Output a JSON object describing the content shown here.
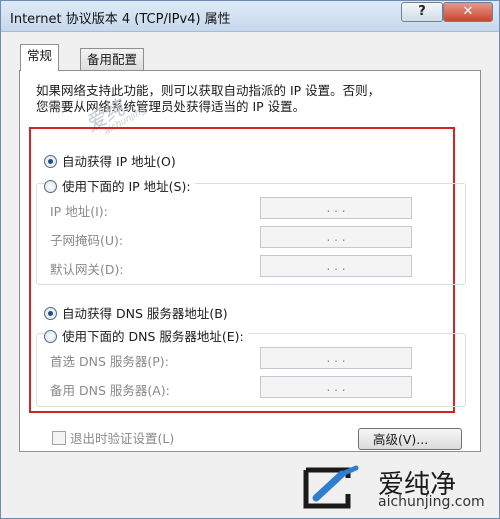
{
  "window": {
    "title": "Internet 协议版本 4 (TCP/IPv4) 属性",
    "help_label": "?",
    "close_label": "✕"
  },
  "tabs": [
    {
      "label": "常规",
      "active": true
    },
    {
      "label": "备用配置",
      "active": false
    }
  ],
  "intro": {
    "line1": "如果网络支持此功能，则可以获取自动指派的 IP 设置。否则，",
    "line2": "您需要从网络系统管理员处获得适当的 IP 设置。"
  },
  "ip_section": {
    "auto_label": "自动获得 IP 地址(O)",
    "auto_checked": true,
    "manual_label": "使用下面的 IP 地址(S):",
    "fields": [
      {
        "label": "IP 地址(I):",
        "value": ". . ."
      },
      {
        "label": "子网掩码(U):",
        "value": ". . ."
      },
      {
        "label": "默认网关(D):",
        "value": ". . ."
      }
    ]
  },
  "dns_section": {
    "auto_label": "自动获得 DNS 服务器地址(B)",
    "auto_checked": true,
    "manual_label": "使用下面的 DNS 服务器地址(E):",
    "fields": [
      {
        "label": "首选 DNS 服务器(P):",
        "value": ". . ."
      },
      {
        "label": "备用 DNS 服务器(A):",
        "value": ". . ."
      }
    ]
  },
  "validate_label": "退出时验证设置(L)",
  "advanced_label": "高级(V)...",
  "watermark": {
    "main": "爱纯",
    "sub": "aichunjing"
  },
  "logo": {
    "name": "爱纯净",
    "url": "aichunjing.com",
    "icon": "logo-mark-icon"
  },
  "colors": {
    "highlight_box": "#d42323",
    "logo_blue": "#2f7fd1"
  }
}
